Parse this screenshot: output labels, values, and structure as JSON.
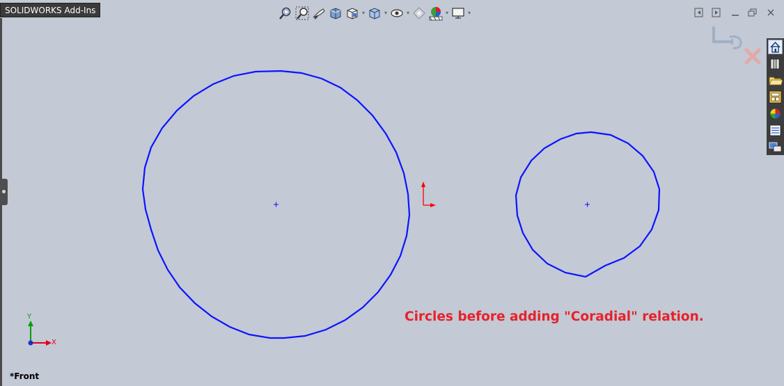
{
  "tab": {
    "label": "SOLIDWORKS Add-Ins"
  },
  "annotation": {
    "text": "Circles before adding \"Coradial\" relation."
  },
  "view": {
    "label": "*Front"
  },
  "triad": {
    "x_label": "X",
    "y_label": "Y"
  },
  "colors": {
    "background": "#c3c9d5",
    "circle": "#0b14ff",
    "annotation": "#e8212a",
    "origin": "#ff0000",
    "triad_x": "#e0001a",
    "triad_y": "#00a000"
  },
  "icons": {
    "hud": [
      "zoom-to-fit-icon",
      "zoom-to-area-icon",
      "previous-view-icon",
      "section-view-icon",
      "view-orientation-icon",
      "display-style-icon",
      "hide-show-items-icon",
      "edit-appearance-icon",
      "apply-scene-icon",
      "view-settings-icon"
    ],
    "window": [
      "tile-left-icon",
      "tile-right-icon",
      "minimize-icon",
      "restore-icon",
      "close-icon"
    ],
    "taskpane": [
      "home-icon",
      "design-library-icon",
      "file-explorer-icon",
      "view-palette-icon",
      "appearances-icon",
      "custom-properties-icon",
      "forum-icon"
    ],
    "confirmation": [
      "confirm-exit-sketch-icon",
      "cancel-sketch-icon"
    ]
  }
}
